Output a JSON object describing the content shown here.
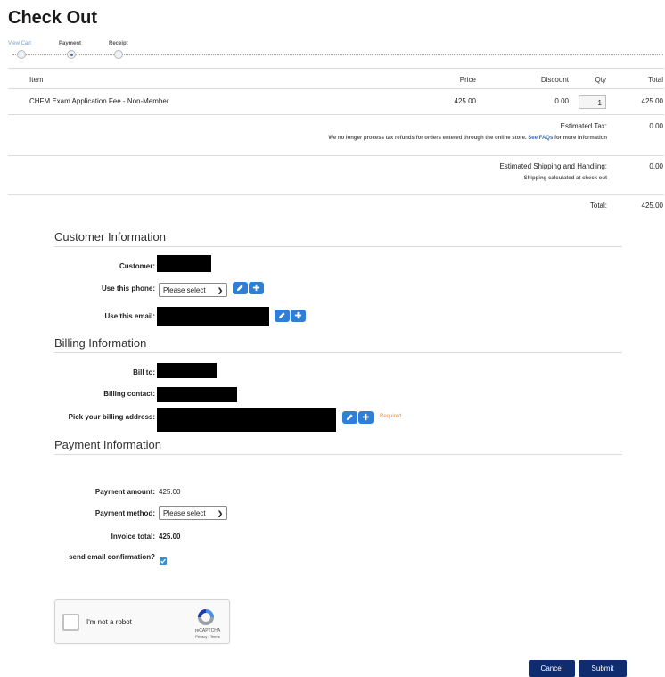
{
  "page_title": "Check Out",
  "steps": [
    {
      "label": "View Cart",
      "state": "done"
    },
    {
      "label": "Payment",
      "state": "active"
    },
    {
      "label": "Receipt",
      "state": "pending"
    }
  ],
  "cart": {
    "headers": {
      "item": "Item",
      "price": "Price",
      "discount": "Discount",
      "qty": "Qty",
      "total": "Total"
    },
    "rows": [
      {
        "item": "CHFM Exam Application Fee - Non-Member",
        "price": "425.00",
        "discount": "0.00",
        "qty": "1",
        "total": "425.00"
      }
    ],
    "tax_label": "Estimated Tax:",
    "tax_value": "0.00",
    "tax_note": "We no longer process tax refunds for orders entered through the online store.",
    "tax_link": "See FAQs",
    "tax_note_end": "for more information",
    "shipping_label": "Estimated Shipping and Handling:",
    "shipping_value": "0.00",
    "shipping_note": "Shipping calculated at check out",
    "total_label": "Total:",
    "total_value": "425.00"
  },
  "customer": {
    "heading": "Customer Information",
    "customer_label": "Customer:",
    "phone_label": "Use this phone:",
    "phone_select": "Please select",
    "email_label": "Use this email:"
  },
  "billing": {
    "heading": "Billing Information",
    "bill_to_label": "Bill to:",
    "contact_label": "Billing contact:",
    "address_label": "Pick your billing address:",
    "required": "Required"
  },
  "payment": {
    "heading": "Payment Information",
    "amount_label": "Payment amount:",
    "amount_value": "425.00",
    "method_label": "Payment method:",
    "method_select": "Please select",
    "invoice_label": "Invoice total:",
    "invoice_value": "425.00",
    "email_confirm_label": "send email confirmation?",
    "email_confirm_checked": true
  },
  "recaptcha": {
    "label": "I'm not a robot",
    "brand": "reCAPTCHA",
    "links": "Privacy - Terms"
  },
  "buttons": {
    "cancel": "Cancel",
    "submit": "Submit"
  },
  "colors": {
    "primary_button": "#0f2c6e",
    "icon_button": "#2f7fd6",
    "link": "#2f6db5",
    "required": "#e69138"
  }
}
